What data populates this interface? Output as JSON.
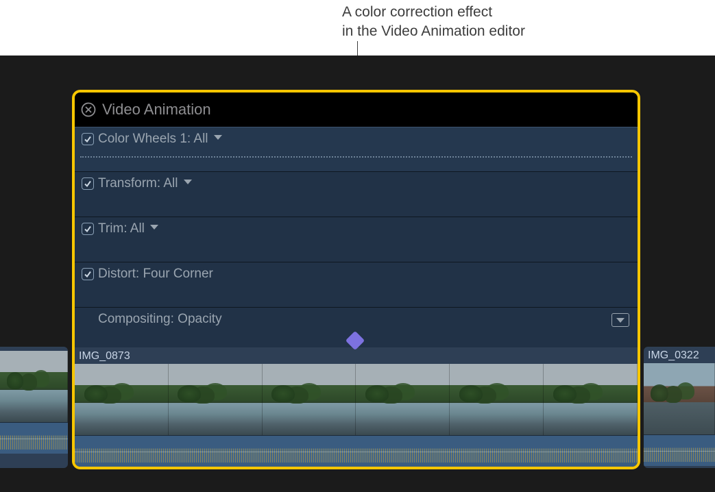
{
  "caption": {
    "line1": "A color correction effect",
    "line2": "in the Video Animation editor"
  },
  "panel": {
    "title": "Video Animation",
    "rows": [
      {
        "label": "Color Wheels 1: All",
        "checked": true,
        "has_chevron": true,
        "highlighted": true,
        "dotted": true
      },
      {
        "label": "Transform: All",
        "checked": true,
        "has_chevron": true,
        "highlighted": false,
        "dotted": false
      },
      {
        "label": "Trim: All",
        "checked": true,
        "has_chevron": true,
        "highlighted": false,
        "dotted": false
      },
      {
        "label": "Distort: Four Corner",
        "checked": true,
        "has_chevron": false,
        "highlighted": false,
        "dotted": false
      }
    ],
    "compositing_label": "Compositing: Opacity"
  },
  "clips": {
    "left_label": "",
    "center_label": "IMG_0873",
    "right_label": "IMG_0322"
  }
}
